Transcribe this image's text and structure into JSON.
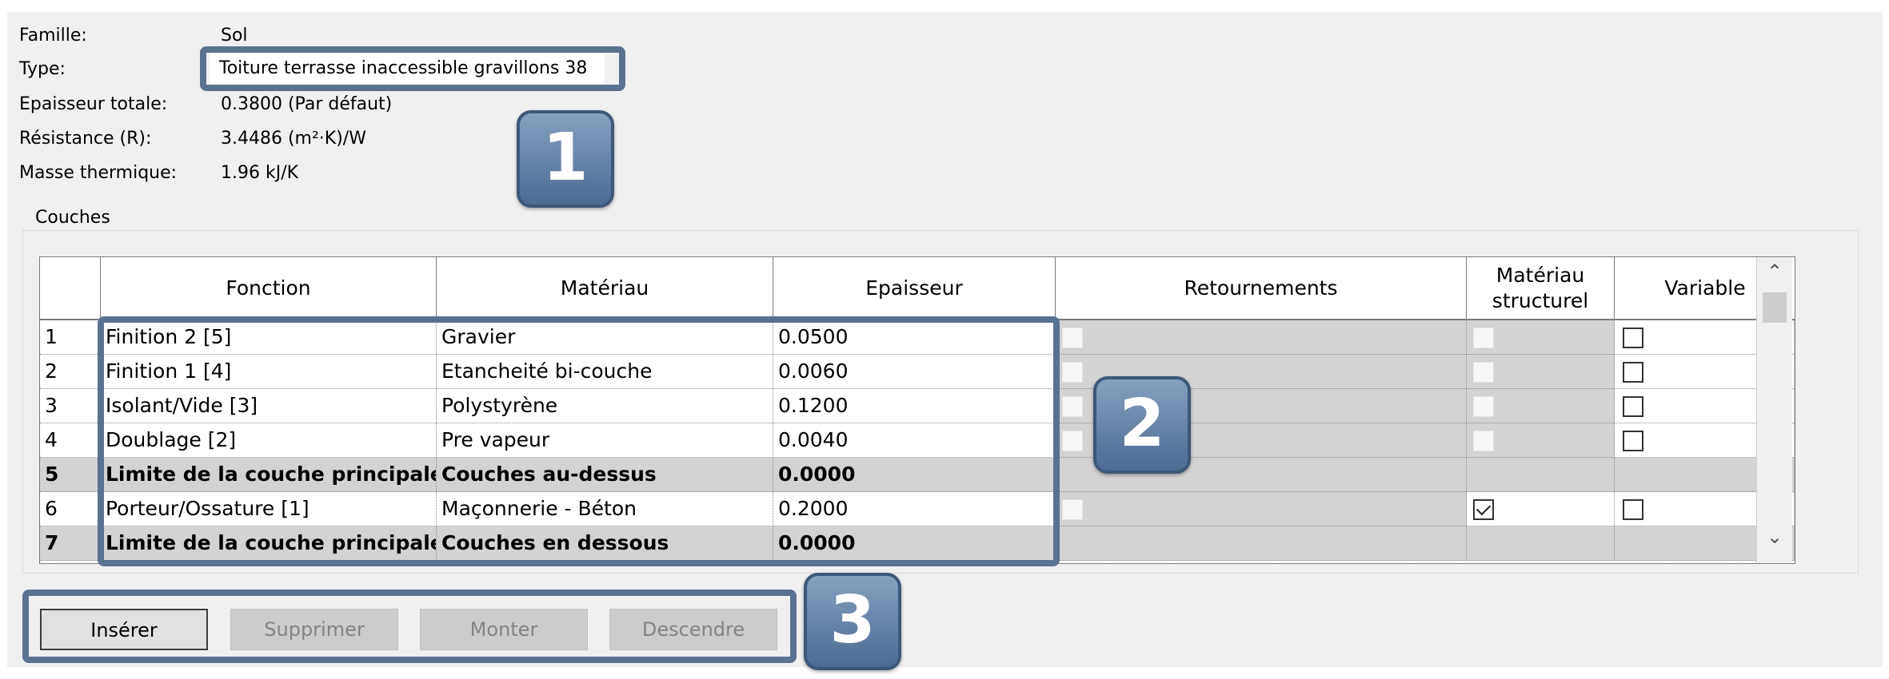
{
  "properties": {
    "famille_label": "Famille:",
    "famille_value": "Sol",
    "type_label": "Type:",
    "type_value": "Toiture terrasse inaccessible gravillons 38",
    "epaisseur_label": "Epaisseur totale:",
    "epaisseur_value": "0.3800 (Par défaut)",
    "resistance_label": "Résistance (R):",
    "resistance_value": "3.4486 (m²·K)/W",
    "masse_label": "Masse thermique:",
    "masse_value": "1.96 kJ/K"
  },
  "layers": {
    "group_title": "Couches",
    "headers": {
      "index": "",
      "fonction": "Fonction",
      "materiau": "Matériau",
      "epaisseur": "Epaisseur",
      "retournements": "Retournements",
      "structurel": "Matériau structurel",
      "variable": "Variable"
    },
    "rows": [
      {
        "n": "1",
        "fonction": "Finition 2 [5]",
        "materiau": "Gravier",
        "epaisseur": "0.0500",
        "boundary": false,
        "structurel_checked": false,
        "variable_checked": false
      },
      {
        "n": "2",
        "fonction": "Finition 1 [4]",
        "materiau": "Etancheité bi-couche",
        "epaisseur": "0.0060",
        "boundary": false,
        "structurel_checked": false,
        "variable_checked": false
      },
      {
        "n": "3",
        "fonction": "Isolant/Vide [3]",
        "materiau": "Polystyrène",
        "epaisseur": "0.1200",
        "boundary": false,
        "structurel_checked": false,
        "variable_checked": false
      },
      {
        "n": "4",
        "fonction": "Doublage [2]",
        "materiau": "Pre vapeur",
        "epaisseur": "0.0040",
        "boundary": false,
        "structurel_checked": false,
        "variable_checked": false
      },
      {
        "n": "5",
        "fonction": "Limite de la couche principale",
        "materiau": "Couches au-dessus",
        "epaisseur": "0.0000",
        "boundary": true
      },
      {
        "n": "6",
        "fonction": "Porteur/Ossature [1]",
        "materiau": "Maçonnerie - Béton",
        "epaisseur": "0.2000",
        "boundary": false,
        "structurel_checked": true,
        "variable_checked": false
      },
      {
        "n": "7",
        "fonction": "Limite de la couche principale",
        "materiau": "Couches en dessous",
        "epaisseur": "0.0000",
        "boundary": true
      }
    ]
  },
  "buttons": {
    "inserer": "Insérer",
    "supprimer": "Supprimer",
    "monter": "Monter",
    "descendre": "Descendre"
  },
  "callouts": [
    "1",
    "2",
    "3"
  ],
  "scroll": {
    "up_glyph": "⌃",
    "down_glyph": "⌄",
    "up_icon": "scroll-up-icon",
    "down_icon": "scroll-down-icon"
  },
  "colors": {
    "highlight": "#5b7190",
    "boundary_row": "#d3d3d3",
    "disabled_button": "#cccccc"
  }
}
